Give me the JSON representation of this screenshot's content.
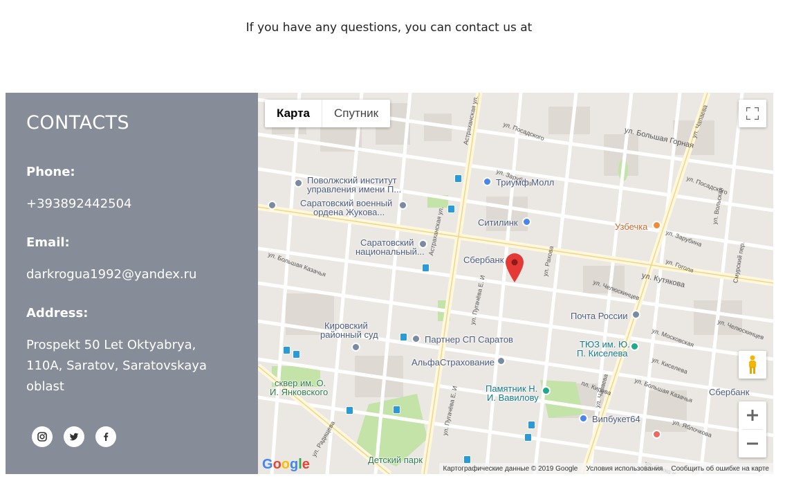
{
  "intro": "If you have any questions, you can contact us at",
  "contacts": {
    "title": "CONTACTS",
    "phone_label": "Phone:",
    "phone": "+393892442504",
    "email_label": "Email:",
    "email": "darkrogua1992@yandex.ru",
    "address_label": "Address:",
    "address": "Prospekt 50 Let Oktyabrya, 110A, Saratov, Saratovskaya oblast",
    "social_icons": [
      "instagram-icon",
      "twitter-icon",
      "facebook-icon"
    ]
  },
  "map": {
    "map_type_selected": "Карта",
    "map_type_other": "Спутник",
    "google_logo": "Google",
    "footer": {
      "data": "Картографические данные © 2019 Google",
      "terms": "Условия использования",
      "report": "Сообщить об ошибке на карте"
    },
    "pois": {
      "p1": "Поволжский институт",
      "p1b": "управления имени П...",
      "p2": "Саратовский военный",
      "p2b": "ордена Жукова...",
      "p3": "Саратовский",
      "p3b": "национальный...",
      "p4": "Триумф Молл",
      "p5": "Ситилинк",
      "p6": "Узбечка",
      "p7": "Сбербанк",
      "p8": "Почта России",
      "p9": "Кировский",
      "p9b": "районный суд",
      "p10": "Партнер СП Саратов",
      "p11": "ТЮЗ им. Ю.",
      "p11b": "П. Киселева",
      "p12": "АльфаСтрахование",
      "p13": "сквер им. О.",
      "p13b": "И. Янковского",
      "p14": "Памятник Н.",
      "p14b": "И. Вавилову",
      "p15": "Сбербанк",
      "p16": "Випбукет64",
      "p17": "Детский парк"
    },
    "streets": {
      "s1": "ул. Большая Горная",
      "s2": "ул. Чапаева",
      "s3": "ул. Посадского",
      "s4": "ул. Зарубина",
      "s5": "ул. Кутякова",
      "s6": "Астраханская ул.",
      "s7": "ул. Большая Казачья",
      "s8": "ул. Московская",
      "s9": "ул. Киселева",
      "s10": "ул. Челюскинцев",
      "s11": "ул. Рахова",
      "s12": "ул. Пугачёва Е. И",
      "s13": "ул. Гоголя",
      "s14": "Смурский пер.",
      "s15": "ул. Вольская",
      "s16": "пл. Кирова",
      "s17": "ул. Яблочкова",
      "s18": "ул. Сакко и",
      "s19": "ул. Радищева",
      "s20": "ул. Зарубина",
      "s21": "Астраханская ул."
    }
  }
}
